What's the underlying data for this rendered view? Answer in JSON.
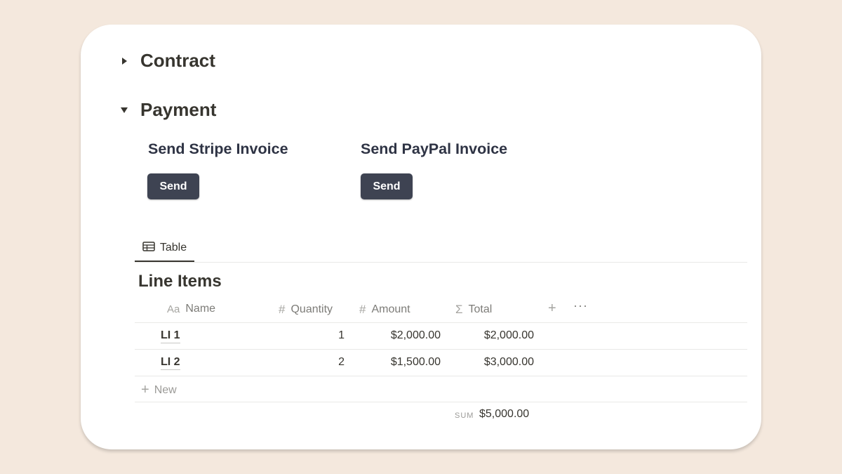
{
  "sections": {
    "contract": {
      "title": "Contract",
      "expanded": false
    },
    "payment": {
      "title": "Payment",
      "expanded": true
    }
  },
  "payment": {
    "stripe": {
      "title": "Send Stripe Invoice",
      "button": "Send"
    },
    "paypal": {
      "title": "Send PayPal Invoice",
      "button": "Send"
    }
  },
  "database": {
    "view_tab": "Table",
    "title": "Line Items",
    "columns": [
      {
        "icon": "Aa",
        "label": "Name"
      },
      {
        "icon": "#",
        "label": "Quantity"
      },
      {
        "icon": "#",
        "label": "Amount"
      },
      {
        "icon": "Σ",
        "label": "Total"
      }
    ],
    "rows": [
      {
        "name": "LI 1",
        "quantity": "1",
        "amount": "$2,000.00",
        "total": "$2,000.00"
      },
      {
        "name": "LI 2",
        "quantity": "2",
        "amount": "$1,500.00",
        "total": "$3,000.00"
      }
    ],
    "new_label": "New",
    "sum_label": "SUM",
    "sum_value": "$5,000.00"
  },
  "colors": {
    "background": "#f4e8dd",
    "button": "#3e4352",
    "text": "#37352f"
  }
}
